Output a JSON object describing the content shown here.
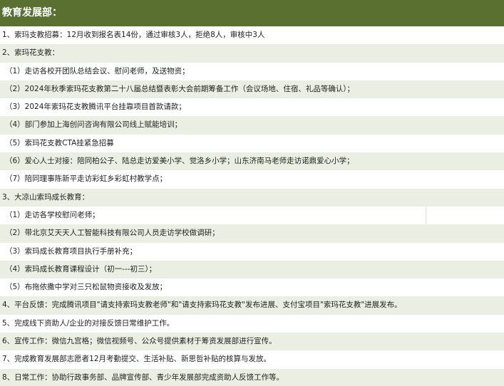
{
  "header": {
    "title": "教育发展部："
  },
  "rows": [
    {
      "text": "1、索玛支教招募：12月收到报名表14份，通过审核3人，拒绝8人，审核中3人",
      "level": 0
    },
    {
      "text": "2、索玛花支教：",
      "level": 0
    },
    {
      "text": "（1）走访各校开团队总结会议、慰问老师，及送物资；",
      "level": 1
    },
    {
      "text": "（2）2024年秋季索玛花支教第二十八届总结暨表彰大会前期筹备工作（会议场地、住宿、礼品等确认）；",
      "level": 1
    },
    {
      "text": "（3）2024年索玛花支教腾讯平台挂靠项目首款请款；",
      "level": 1
    },
    {
      "text": "（4）部门参加上海创问咨询有限公司线上赋能培训；",
      "level": 1
    },
    {
      "text": "（5）索玛花支教CTA挂紧急招募",
      "level": 1
    },
    {
      "text": "（6）爱心人士对接：陪同柏公子、陆总走访爱美小学、觉洛乡小学；山东济南马老师走访诺鼎爱心小学；",
      "level": 1
    },
    {
      "text": "（7）陪同理事陈新平走访彩虹乡彩虹村教学点；",
      "level": 1
    },
    {
      "text": "3、大凉山索玛成长教育：",
      "level": 0
    },
    {
      "text": "（1）走访各学校慰问老师；",
      "level": 1,
      "split": true
    },
    {
      "text": "（2）带北京艾天天人工智能科技有限公司人员走访学校做调研；",
      "level": 1
    },
    {
      "text": "（3）索玛成长教育项目执行手册补充；",
      "level": 1
    },
    {
      "text": "（4）索玛成长教育课程设计（初一---初三）；",
      "level": 1
    },
    {
      "text": "（5）布拖依撒中学对三只松鼠物资接收及发放；",
      "level": 1
    },
    {
      "text": "4、平台反馈：完成腾讯项目\"请支持索玛支教老师\"和\"请支持索玛花支教\"发布进展、支付宝项目\"索玛花支教\"进展发布。",
      "level": 0
    },
    {
      "text": "5、完成线下资助人/企业的对接反馈日常维护工作。",
      "level": 0
    },
    {
      "text": "6、宣传工作：微信九宫格；微信视频号、公众号提供素材于筹资发展部进行宣传。",
      "level": 0
    },
    {
      "text": "7、完成教育发展部志愿者12月考勤提交、生活补贴、新思哲补贴的核算与发放。",
      "level": 0
    },
    {
      "text": "8、日常工作：协助行政事务部、品牌宣传部、青少年发展部完成资助人反馈工作等。",
      "level": 0
    }
  ]
}
